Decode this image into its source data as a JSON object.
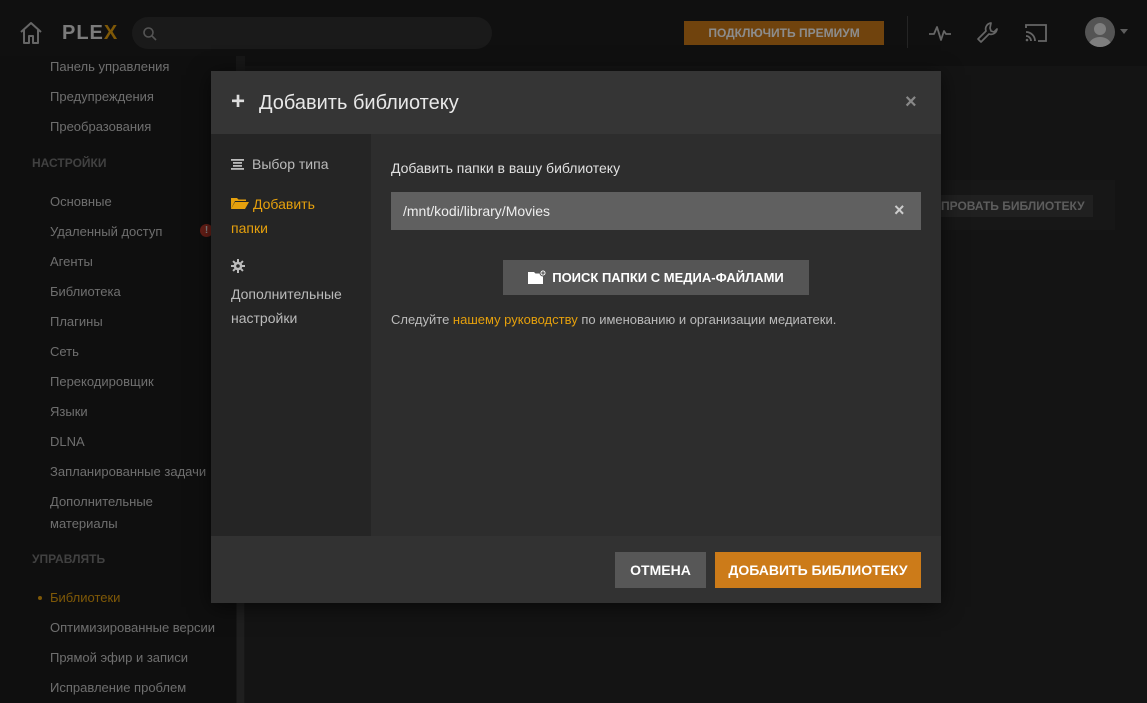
{
  "topbar": {
    "logo_main": "PLE",
    "logo_accent": "X",
    "search_placeholder": "",
    "premium_label": "ПОДКЛЮЧИТЬ ПРЕМИУМ"
  },
  "sidebar": {
    "top_items": [
      {
        "label": "Панель управления"
      },
      {
        "label": "Предупреждения"
      },
      {
        "label": "Преобразования"
      }
    ],
    "settings_header": "НАСТРОЙКИ",
    "settings_items": [
      {
        "label": "Основные"
      },
      {
        "label": "Удаленный доступ"
      },
      {
        "label": "Агенты"
      },
      {
        "label": "Библиотека"
      },
      {
        "label": "Плагины"
      },
      {
        "label": "Сеть"
      },
      {
        "label": "Перекодировщик"
      },
      {
        "label": "Языки"
      },
      {
        "label": "DLNA"
      },
      {
        "label": "Запланированные задачи"
      },
      {
        "label": "Дополнительные"
      },
      {
        "label": "материалы"
      }
    ],
    "warning_glyph": "!",
    "manage_header": "УПРАВЛЯТЬ",
    "manage_items": [
      {
        "label": "Библиотеки"
      },
      {
        "label": "Оптимизированные версии"
      },
      {
        "label": "Прямой эфир и записи"
      },
      {
        "label": "Исправление проблем"
      }
    ]
  },
  "background": {
    "partial_button": "ПРОВАТЬ БИБЛИОТЕКУ"
  },
  "modal": {
    "plus": "+",
    "title": "Добавить библиотеку",
    "close": "×",
    "nav": {
      "type": "Выбор типа",
      "add_folders_1": "Добавить",
      "add_folders_2": "папки",
      "advanced_1": "Дополнительные",
      "advanced_2": "настройки"
    },
    "body": {
      "label": "Добавить папки в вашу библиотеку",
      "path_value": "/mnt/kodi/library/Movies",
      "clear": "×",
      "browse_label": "ПОИСК ПАПКИ С МЕДИА-ФАЙЛАМИ",
      "hint_before": "Следуйте ",
      "hint_link": "нашему руководству",
      "hint_after": " по именованию и организации медиатеки."
    },
    "footer": {
      "cancel": "ОТМЕНА",
      "add": "ДОБАВИТЬ БИБЛИОТЕКУ"
    }
  },
  "colors": {
    "accent": "#e5a00d",
    "premium_bg": "#cc7b19",
    "warning": "#c0392b"
  }
}
